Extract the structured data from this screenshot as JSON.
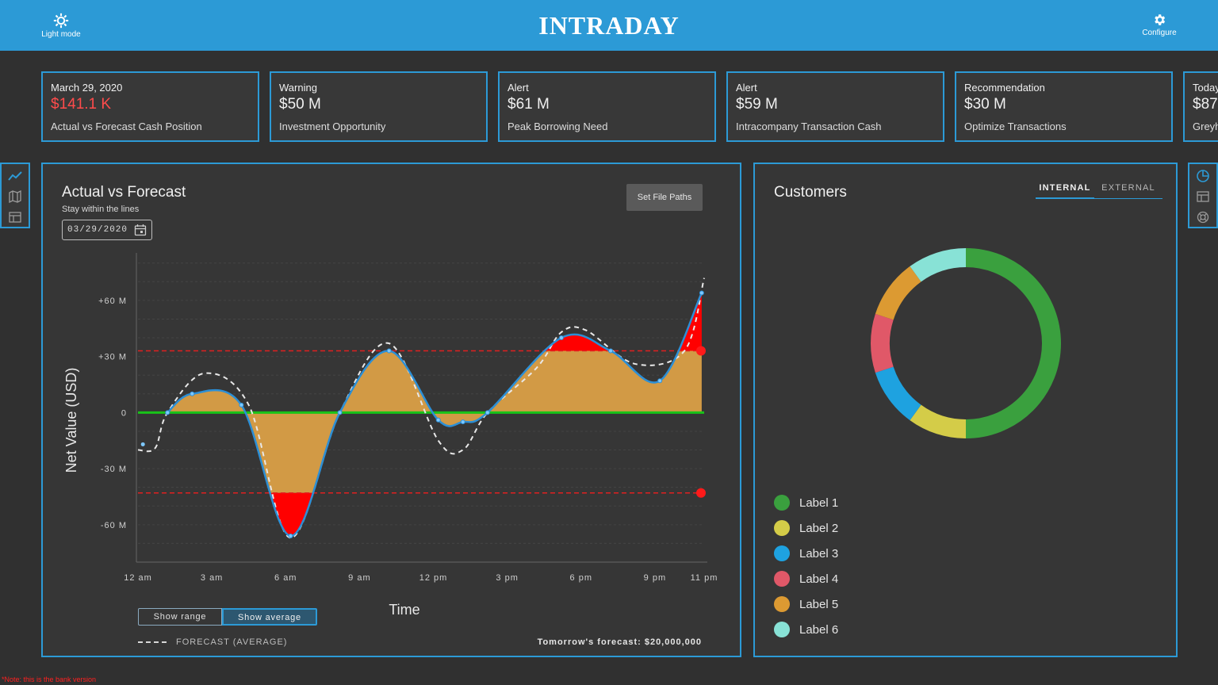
{
  "header": {
    "brand": "INTRADAY",
    "light_mode_label": "Light mode",
    "configure_label": "Configure"
  },
  "cards": [
    {
      "label": "March 29, 2020",
      "value": "$141.1 K",
      "desc": "Actual vs Forecast Cash Position",
      "value_color": "#ff4b4b"
    },
    {
      "label": "Warning",
      "value": "$50 M",
      "desc": "Investment Opportunity"
    },
    {
      "label": "Alert",
      "value": "$61 M",
      "desc": "Peak Borrowing Need"
    },
    {
      "label": "Alert",
      "value": "$59 M",
      "desc": "Intracompany Transaction Cash"
    },
    {
      "label": "Recommendation",
      "value": "$30 M",
      "desc": "Optimize Transactions"
    },
    {
      "label": "Today",
      "value": "$87",
      "desc": "Greyh"
    }
  ],
  "left_nav": {
    "icons": [
      "line-chart-icon",
      "map-icon",
      "table-icon"
    ]
  },
  "right_nav": {
    "icons": [
      "pie-chart-icon",
      "table-icon",
      "lifebuoy-icon"
    ]
  },
  "actual_vs_forecast": {
    "title": "Actual vs Forecast",
    "subtitle": "Stay within the lines",
    "date_value": "03/29/2020",
    "set_file_paths_label": "Set File Paths",
    "show_range_label": "Show range",
    "show_average_label": "Show average",
    "forecast_legend": "FORECAST (AVERAGE)",
    "tomorrow_forecast": "Tomorrow's forecast: $20,000,000"
  },
  "customers": {
    "title": "Customers",
    "tabs": [
      {
        "label": "INTERNAL",
        "active": true
      },
      {
        "label": "EXTERNAL",
        "active": false
      }
    ],
    "legend": [
      {
        "label": "Label 1",
        "color": "#3aa03e"
      },
      {
        "label": "Label 2",
        "color": "#d4cc48"
      },
      {
        "label": "Label 3",
        "color": "#1ea2e0"
      },
      {
        "label": "Label 4",
        "color": "#e05868"
      },
      {
        "label": "Label 5",
        "color": "#dc9a32"
      },
      {
        "label": "Label 6",
        "color": "#88e2d6"
      }
    ]
  },
  "chart_data": [
    {
      "type": "line",
      "title": "Actual vs Forecast",
      "xlabel": "Time",
      "ylabel": "Net Value (USD)",
      "x_ticks": [
        "12 am",
        "3 am",
        "6 am",
        "9 am",
        "12 pm",
        "3 pm",
        "6 pm",
        "9 pm",
        "11 pm"
      ],
      "y_ticks": [
        "+60 M",
        "+30 M",
        "0",
        "-30 M",
        "-60 M"
      ],
      "y_tick_values": [
        60,
        30,
        0,
        -30,
        -60
      ],
      "ylim": [
        -80,
        82
      ],
      "xlim": [
        0,
        23
      ],
      "unit": "M",
      "upper_limit": 33,
      "lower_limit": -43,
      "series": [
        {
          "role": "actual",
          "x": [
            1.2,
            2.2,
            4.2,
            6.2,
            8.2,
            10.2,
            12.2,
            13.2,
            14.2,
            17.2,
            19.2,
            21.2,
            22.9
          ],
          "values": [
            0,
            10,
            4,
            -66,
            0,
            33,
            -4,
            -5,
            0,
            40,
            33,
            17,
            64
          ]
        },
        {
          "role": "forecast",
          "name": "FORECAST (AVERAGE)",
          "x": [
            0,
            0.7,
            1.2,
            2.7,
            4.5,
            6.2,
            8.2,
            10.2,
            12.2,
            13.2,
            14.2,
            16.2,
            17.2,
            18.2,
            20.2,
            22.2,
            23
          ],
          "values": [
            -20,
            -19,
            0,
            21,
            4,
            -67,
            0,
            37,
            -15,
            -20,
            0,
            24,
            43,
            44,
            26,
            33,
            72
          ]
        }
      ],
      "legend_position": "bottom-left",
      "grid": true
    },
    {
      "type": "pie",
      "title": "Customers",
      "categories": [
        "Label 1",
        "Label 2",
        "Label 3",
        "Label 4",
        "Label 5",
        "Label 6"
      ],
      "values": [
        50,
        10,
        10,
        10,
        10,
        10
      ],
      "colors": [
        "#3aa03e",
        "#d4cc48",
        "#1ea2e0",
        "#e05868",
        "#dc9a32",
        "#88e2d6"
      ]
    }
  ],
  "footer_note": "*Note: this is the bank version"
}
